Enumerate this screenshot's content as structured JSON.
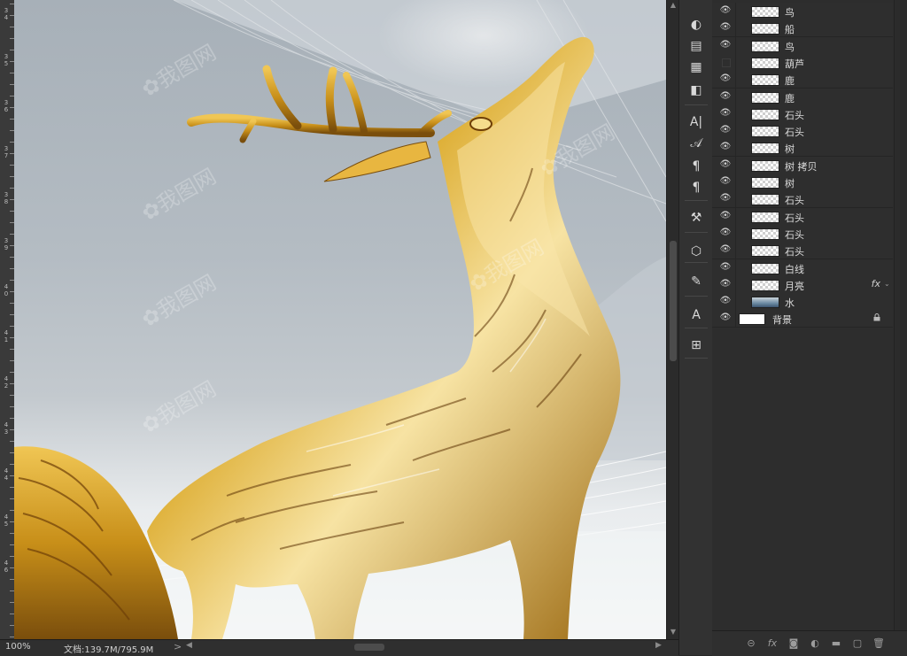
{
  "status": {
    "zoom": "100%",
    "doc_info": "文档:139.7M/795.9M",
    "nav_arrow": ">"
  },
  "ruler": {
    "labels": [
      "3",
      "4",
      "3",
      "5",
      "3",
      "6",
      "3",
      "7",
      "3",
      "8",
      "3",
      "9",
      "4",
      "0",
      "4",
      "1",
      "4",
      "2",
      "4",
      "3",
      "4",
      "4",
      "4",
      "5",
      "4",
      "6"
    ]
  },
  "tools": [
    {
      "icon": "adjustment-icon",
      "glyph": "◐"
    },
    {
      "icon": "properties-icon",
      "glyph": "▤"
    },
    {
      "icon": "document-icon",
      "glyph": "▦"
    },
    {
      "icon": "history-icon",
      "glyph": "◧"
    },
    {
      "icon": "character-icon",
      "glyph": "A|"
    },
    {
      "icon": "glyph-icon",
      "glyph": "𝒜"
    },
    {
      "icon": "paragraph-style-icon",
      "glyph": "¶"
    },
    {
      "icon": "paragraph-icon",
      "glyph": "¶"
    },
    {
      "icon": "tool-presets-icon",
      "glyph": "⚒"
    },
    {
      "icon": "3d-cube-icon",
      "glyph": "⬡"
    },
    {
      "icon": "brush-icon",
      "glyph": "✎"
    },
    {
      "icon": "clone-source-icon",
      "glyph": "A"
    },
    {
      "icon": "timeline-icon",
      "glyph": "⊞"
    }
  ],
  "layers": [
    {
      "name": "鸟",
      "visible": true,
      "thumb": "checker"
    },
    {
      "name": "船",
      "visible": true,
      "thumb": "checker"
    },
    {
      "name": "鸟",
      "visible": true,
      "thumb": "checker"
    },
    {
      "name": "葫芦",
      "visible": false,
      "thumb": "checker"
    },
    {
      "name": "鹿",
      "visible": true,
      "thumb": "checker"
    },
    {
      "name": "鹿",
      "visible": true,
      "thumb": "checker"
    },
    {
      "name": "石头",
      "visible": true,
      "thumb": "checker"
    },
    {
      "name": "石头",
      "visible": true,
      "thumb": "checker"
    },
    {
      "name": "树",
      "visible": true,
      "thumb": "checker"
    },
    {
      "name": "树 拷贝",
      "visible": true,
      "thumb": "checker"
    },
    {
      "name": "树",
      "visible": true,
      "thumb": "checker"
    },
    {
      "name": "石头",
      "visible": true,
      "thumb": "checker"
    },
    {
      "name": "石头",
      "visible": true,
      "thumb": "checker"
    },
    {
      "name": "石头",
      "visible": true,
      "thumb": "checker"
    },
    {
      "name": "石头",
      "visible": true,
      "thumb": "checker"
    },
    {
      "name": "白线",
      "visible": true,
      "thumb": "checker"
    },
    {
      "name": "月亮",
      "visible": true,
      "thumb": "checker",
      "fx": "fx"
    },
    {
      "name": "水",
      "visible": true,
      "thumb": "water"
    },
    {
      "name": "背景",
      "visible": true,
      "thumb": "white",
      "locked": true
    }
  ],
  "footer_icons": [
    "link-layers-icon",
    "fx-icon",
    "add-mask-icon",
    "adjustment-layer-icon",
    "group-folder-icon",
    "new-layer-icon",
    "trash-icon"
  ],
  "footer_fx_label": "fx",
  "colors": {
    "panel_bg": "#2d2d2d",
    "deer_gold": "#d9a521"
  }
}
